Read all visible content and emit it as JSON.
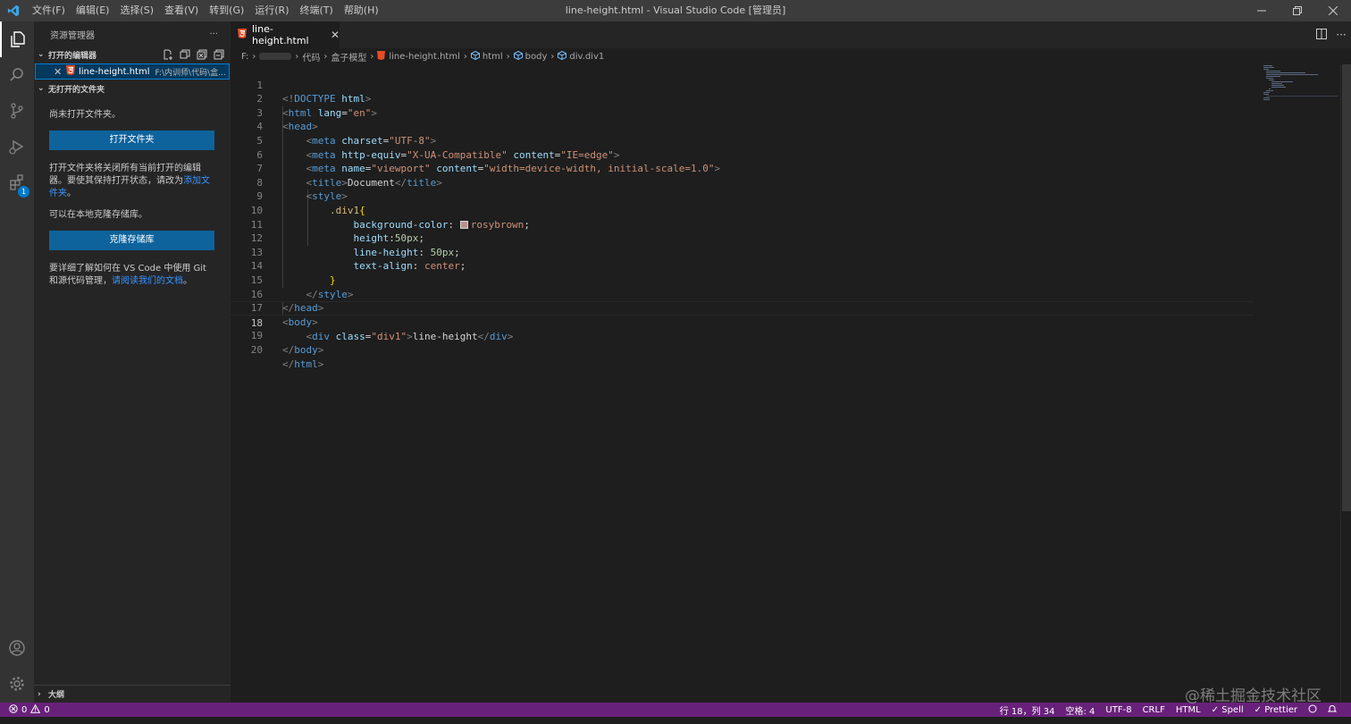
{
  "window": {
    "title": "line-height.html - Visual Studio Code [管理员]",
    "menu": [
      "文件(F)",
      "编辑(E)",
      "选择(S)",
      "查看(V)",
      "转到(G)",
      "运行(R)",
      "终端(T)",
      "帮助(H)"
    ]
  },
  "activity_bar": {
    "extensions_badge": "1"
  },
  "sidebar": {
    "title": "资源管理器",
    "more": "···",
    "open_editors_header": "打开的编辑器",
    "open_editor": {
      "name": "line-height.html",
      "path": "F:\\内训师\\代码\\盒..."
    },
    "no_folder_header": "无打开的文件夹",
    "no_folder_msg": "尚未打开文件夹。",
    "open_folder_button": "打开文件夹",
    "info_text": "打开文件夹将关闭所有当前打开的编辑器。要使其保持打开状态，请改为",
    "info_link": "添加文件夹",
    "info_end": "。",
    "clone_msg": "可以在本地克隆存储库。",
    "clone_button": "克隆存储库",
    "learn_text": "要详细了解如何在 VS Code 中使用 Git 和源代码管理，",
    "learn_link": "请阅读我们的文档",
    "learn_end": "。",
    "outline_header": "大纲"
  },
  "editor": {
    "tab_label": "line-height.html",
    "breadcrumb": {
      "drive": "F:",
      "folder1": "代码",
      "folder2": "盒子模型",
      "file": "line-height.html",
      "el1": "html",
      "el2": "body",
      "el3": "div.div1"
    },
    "line_numbers": [
      "1",
      "2",
      "3",
      "4",
      "5",
      "6",
      "7",
      "8",
      "9",
      "10",
      "11",
      "12",
      "13",
      "14",
      "15",
      "16",
      "17",
      "18",
      "19",
      "20"
    ],
    "current_line": 18,
    "code": {
      "doctype_open": "<!",
      "doctype_kw": "DOCTYPE",
      "doctype_html": " html",
      "gt": ">",
      "lt": "<",
      "lt_slash": "</",
      "tag_html": "html",
      "attr_lang": "lang",
      "eq": "=",
      "val_en": "\"en\"",
      "tag_head": "head",
      "tag_meta": "meta",
      "attr_charset": "charset",
      "val_utf8": "\"UTF-8\"",
      "attr_http_equiv": "http-equiv",
      "val_xua": "\"X-UA-Compatible\"",
      "attr_content": "content",
      "val_ie_edge": "\"IE=edge\"",
      "attr_name": "name",
      "val_viewport": "\"viewport\"",
      "val_viewport_content": "\"width=device-width, initial-scale=1.0\"",
      "tag_title": "title",
      "title_text": "Document",
      "tag_style": "style",
      "selector": ".div1",
      "brace_open": "{",
      "brace_close": "}",
      "prop_bg": "background-color",
      "colon": ": ",
      "val_rosybrown": "rosybrown",
      "semi": ";",
      "prop_height": "height",
      "colon_tight": ":",
      "val_50px": "50px",
      "prop_lineheight": "line-height",
      "prop_textalign": "text-align",
      "val_center": "center",
      "tag_body": "body",
      "tag_div": "div",
      "attr_class": "class",
      "val_div1": "\"div1\"",
      "div_text": "line-height"
    }
  },
  "statusbar": {
    "errors": "0",
    "warnings": "0",
    "position": "行 18，列 34",
    "spaces": "空格: 4",
    "encoding": "UTF-8",
    "eol": "CRLF",
    "language": "HTML",
    "spell": "Spell",
    "prettier": "Prettier"
  },
  "watermark": "@稀土掘金技术社区",
  "colors": {
    "statusbar": "#68217a",
    "activity_bar": "#333333",
    "sidebar": "#252526",
    "editor": "#1e1e1e",
    "button": "#0e639c",
    "swatch_rosybrown": "#bc8f8f"
  }
}
